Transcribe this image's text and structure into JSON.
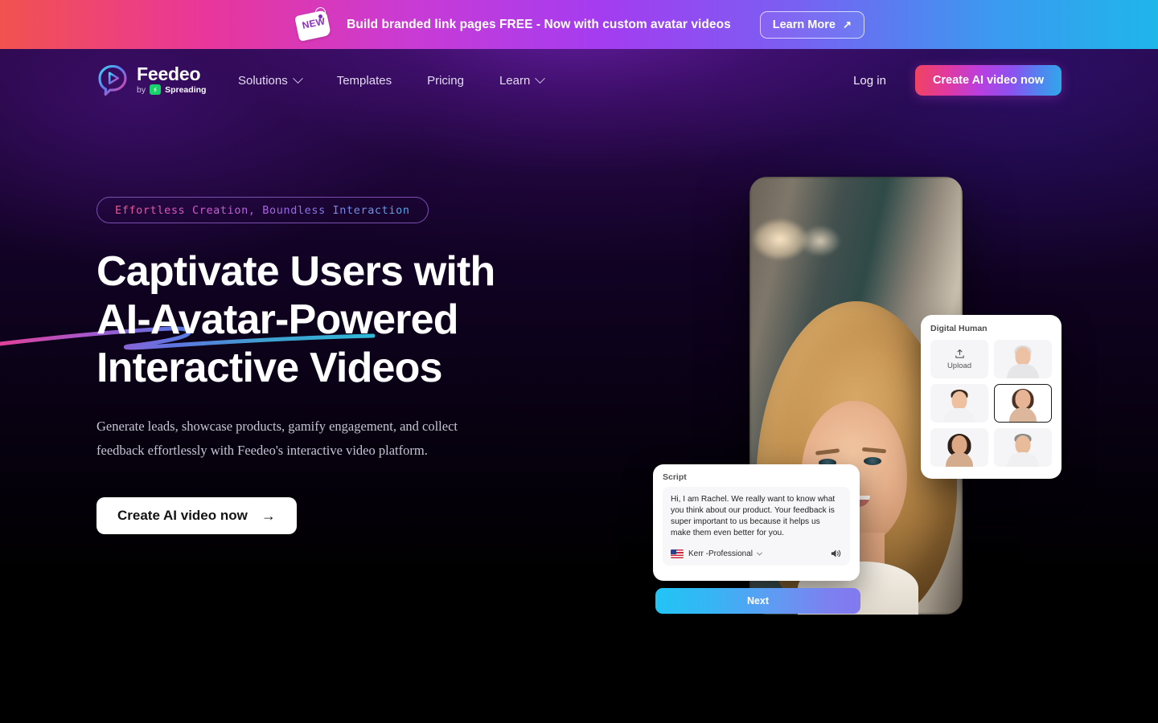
{
  "banner": {
    "tag_label": "NEW",
    "tag_icon": "price-tag-icon",
    "message": "Build branded link pages FREE - Now with custom avatar videos",
    "learn_more_label": "Learn More",
    "learn_more_arrow": "↗"
  },
  "header": {
    "logo": {
      "mark_icon": "feedeo-play-bubble-icon",
      "name": "Feedeo",
      "by_text": "by",
      "parent_badge_icon": "spreading-logo-icon",
      "parent_name": "Spreading"
    },
    "nav": [
      {
        "label": "Solutions",
        "has_chevron": true
      },
      {
        "label": "Templates",
        "has_chevron": false
      },
      {
        "label": "Pricing",
        "has_chevron": false
      },
      {
        "label": "Learn",
        "has_chevron": true
      }
    ],
    "login_label": "Log in",
    "cta_label": "Create AI video now"
  },
  "hero": {
    "eyebrow": "Effortless Creation, Boundless Interaction",
    "title_lines": [
      "Captivate Users with",
      "AI-Avatar-Powered",
      "Interactive Videos"
    ],
    "subtitle": "Generate leads, showcase products, gamify engagement, and collect feedback effortlessly with Feedeo's interactive video platform.",
    "cta_label": "Create AI video now",
    "cta_arrow": "→"
  },
  "mockup": {
    "preview_alt": "smiling-blonde-woman-portrait",
    "digital_human": {
      "title": "Digital Human",
      "upload_label": "Upload",
      "upload_icon": "upload-icon",
      "avatars": [
        {
          "name": "avatar-senior-woman",
          "selected": false
        },
        {
          "name": "avatar-young-man",
          "selected": false
        },
        {
          "name": "avatar-brunette-woman",
          "selected": true
        },
        {
          "name": "avatar-curly-woman",
          "selected": false
        },
        {
          "name": "avatar-bearded-man",
          "selected": false
        }
      ]
    },
    "script": {
      "title": "Script",
      "body": "Hi, I am Rachel. We really want to know what you think about our product. Your feedback is super important to us because it helps us make them even better for you.",
      "voice_flag": "us-flag-icon",
      "voice_name": "Kerr -Professional",
      "voice_chevron": "chevron-down-icon",
      "speaker_icon": "speaker-icon"
    },
    "next_label": "Next"
  },
  "colors": {
    "banner_start": "#f2524f",
    "banner_end": "#1fb6ea",
    "cta_gradient_start": "#f0445f",
    "cta_gradient_end": "#2fa9e8",
    "next_gradient_start": "#22c4f5",
    "next_gradient_end": "#8279ef",
    "page_background": "#000000",
    "hero_glow": "#7823be"
  }
}
